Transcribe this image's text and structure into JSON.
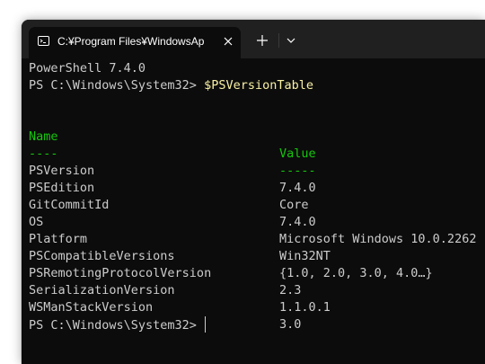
{
  "tab": {
    "title": "C:¥Program Files¥WindowsAp",
    "icon": "terminal-icon"
  },
  "controls": {
    "close_icon": "close-icon",
    "new_tab_icon": "plus-icon",
    "dropdown_icon": "chevron-down-icon"
  },
  "terminal": {
    "banner": "PowerShell 7.4.0",
    "prompt1": "PS C:\\Windows\\System32> ",
    "command": "$PSVersionTable",
    "header_name": "Name",
    "header_value": "Value",
    "underline_name": "----",
    "underline_value": "-----",
    "rows": [
      {
        "name": "PSVersion",
        "value": "7.4.0"
      },
      {
        "name": "PSEdition",
        "value": "Core"
      },
      {
        "name": "GitCommitId",
        "value": "7.4.0"
      },
      {
        "name": "OS",
        "value": "Microsoft Windows 10.0.2262"
      },
      {
        "name": "Platform",
        "value": "Win32NT"
      },
      {
        "name": "PSCompatibleVersions",
        "value": "{1.0, 2.0, 3.0, 4.0…}"
      },
      {
        "name": "PSRemotingProtocolVersion",
        "value": "2.3"
      },
      {
        "name": "SerializationVersion",
        "value": "1.1.0.1"
      },
      {
        "name": "WSManStackVersion",
        "value": "3.0"
      }
    ],
    "prompt2": "PS C:\\Windows\\System32> "
  },
  "colors": {
    "background": "#0c0c0c",
    "foreground": "#cccccc",
    "header": "#16c60c",
    "command": "#f9f1a5"
  }
}
